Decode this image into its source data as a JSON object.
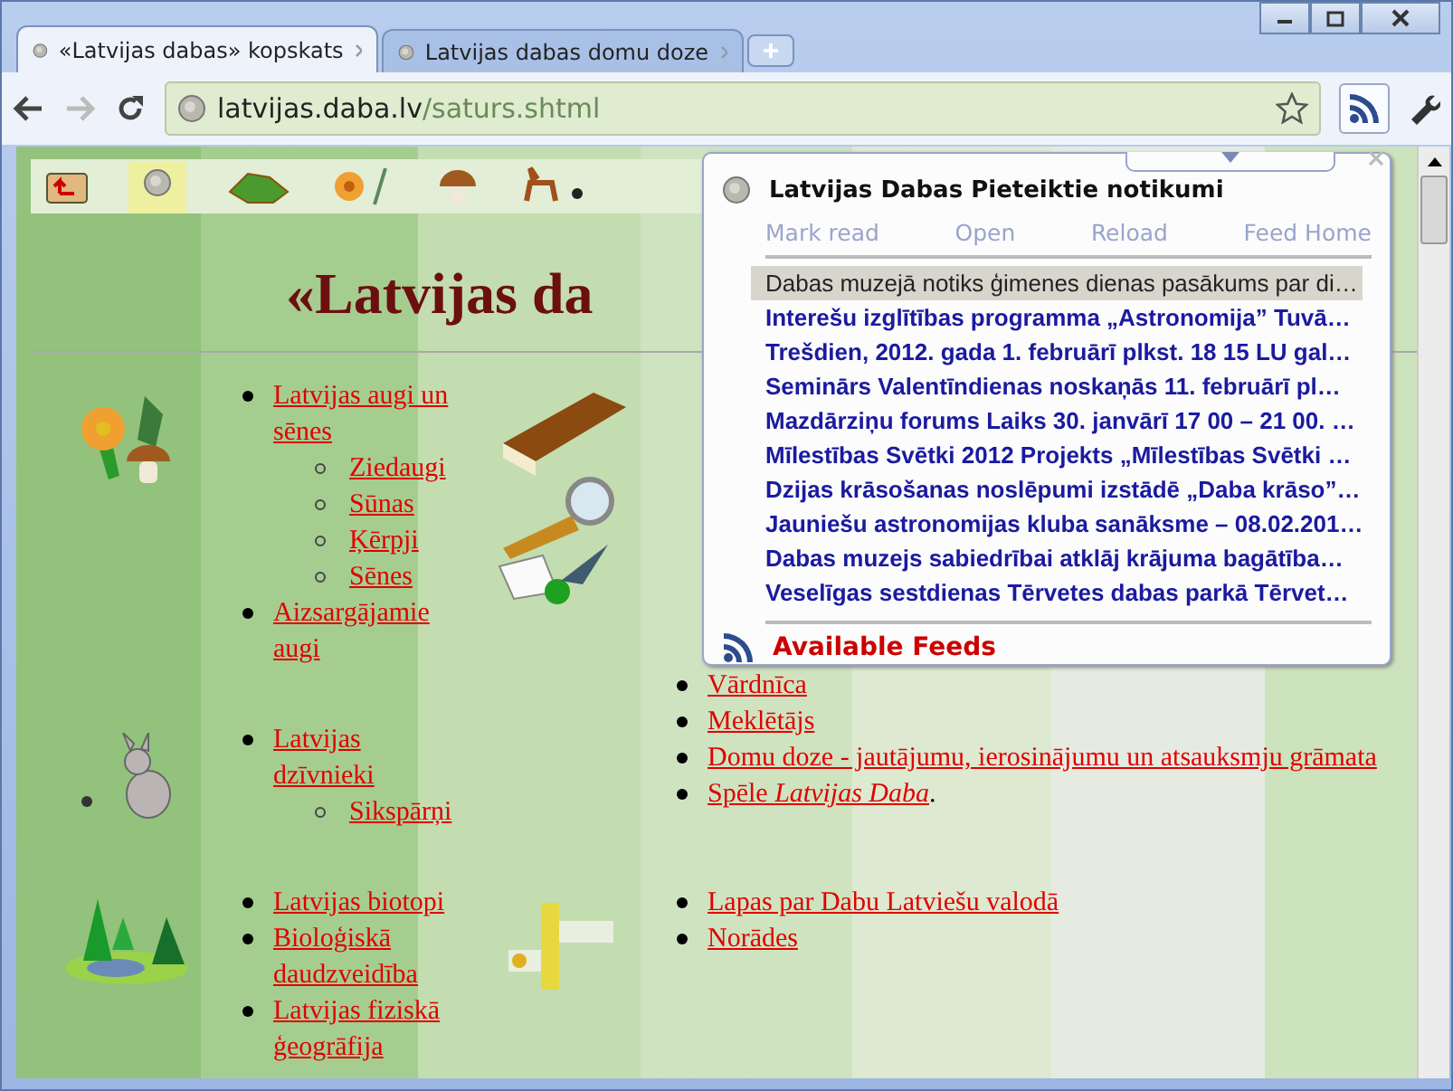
{
  "tabs": [
    {
      "title": "«Latvijas dabas» kopskats",
      "selected": true
    },
    {
      "title": "Latvijas dabas domu doze",
      "selected": false
    }
  ],
  "address": {
    "host": "latvijas.daba.lv",
    "path": "/saturs.shtml"
  },
  "page": {
    "heading": "«Latvijas da",
    "sections": [
      {
        "links": [
          {
            "text": "Latvijas augi un sēnes",
            "children": [
              {
                "text": "Ziedaugi"
              },
              {
                "text": "Sūnas"
              },
              {
                "text": "Ķērpji"
              },
              {
                "text": "Sēnes"
              }
            ]
          },
          {
            "text": "Aizsargājamie augi"
          }
        ],
        "side_links": [
          {
            "text": "Vārdnīca"
          },
          {
            "text": "Meklētājs"
          },
          {
            "text": "Domu doze - jautājumu, ierosinājumu un atsauksmju grāmata"
          },
          {
            "text": "Spēle *Latvijas Daba*",
            "suffix": "."
          }
        ]
      },
      {
        "links": [
          {
            "text": "Latvijas dzīvnieki",
            "children": [
              {
                "text": "Sikspārņi"
              }
            ]
          }
        ]
      },
      {
        "links": [
          {
            "text": "Latvijas biotopi"
          },
          {
            "text": "Bioloģiskā daudzveidība"
          },
          {
            "text": "Latvijas fiziskā ģeogrāfija"
          }
        ],
        "side_links": [
          {
            "text": "Lapas par Dabu Latviešu valodā"
          },
          {
            "text": "Norādes"
          }
        ]
      }
    ]
  },
  "popup": {
    "title": "Latvijas Dabas Pieteiktie notikumi",
    "actions": [
      "Mark read",
      "Open",
      "Reload",
      "Feed Home"
    ],
    "items": [
      {
        "text": "Dabas muzejā notiks ģimenes dienas pasākums par di…",
        "selected": true
      },
      {
        "text": "Interešu izglītības programma „Astronomija” Tuvā…",
        "selected": false
      },
      {
        "text": "Trešdien, 2012. gada 1. februārī plkst. 18 15 LU gal…",
        "selected": false
      },
      {
        "text": "Seminārs Valentīndienas noskaņās 11. februārī pl…",
        "selected": false
      },
      {
        "text": "Mazdārziņu forums Laiks 30. janvārī 17 00 – 21 00. …",
        "selected": false
      },
      {
        "text": "Mīlestības Svētki 2012 Projekts „Mīlestības Svētki …",
        "selected": false
      },
      {
        "text": "Dzijas krāsošanas noslēpumi izstādē „Daba krāso”…",
        "selected": false
      },
      {
        "text": "Jauniešu astronomijas kluba sanāksme – 08.02.201…",
        "selected": false
      },
      {
        "text": "Dabas muzejs sabiedrībai atklāj krājuma bagātība…",
        "selected": false
      },
      {
        "text": "Veselīgas sestdienas Tērvetes dabas parkā Tērvet…",
        "selected": false
      }
    ],
    "footer": "Available Feeds"
  }
}
